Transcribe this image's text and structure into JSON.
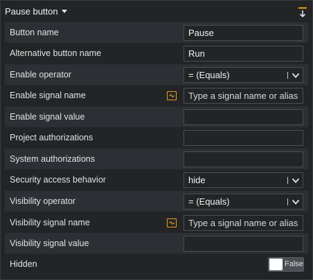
{
  "panel": {
    "title": "Pause button",
    "pin_icon": "pin-down-icon",
    "accent_color": "#f0a020"
  },
  "rows": {
    "button_name": {
      "label": "Button name",
      "value": "Pause"
    },
    "alt_button_name": {
      "label": "Alternative button name",
      "value": "Run"
    },
    "enable_operator": {
      "label": "Enable operator",
      "value": "= (Equals)"
    },
    "enable_signal_name": {
      "label": "Enable signal name",
      "placeholder": "Type a signal name or alias"
    },
    "enable_signal_value": {
      "label": "Enable signal value",
      "value": ""
    },
    "project_auth": {
      "label": "Project authorizations",
      "value": ""
    },
    "system_auth": {
      "label": "System authorizations",
      "value": ""
    },
    "security_behavior": {
      "label": "Security access behavior",
      "value": "hide"
    },
    "visibility_operator": {
      "label": "Visibility operator",
      "value": "= (Equals)"
    },
    "visibility_signal_name": {
      "label": "Visibility signal name",
      "placeholder": "Type a signal name or alias"
    },
    "visibility_signal_value": {
      "label": "Visibility signal value",
      "value": ""
    },
    "hidden": {
      "label": "Hidden",
      "value": "False"
    }
  }
}
